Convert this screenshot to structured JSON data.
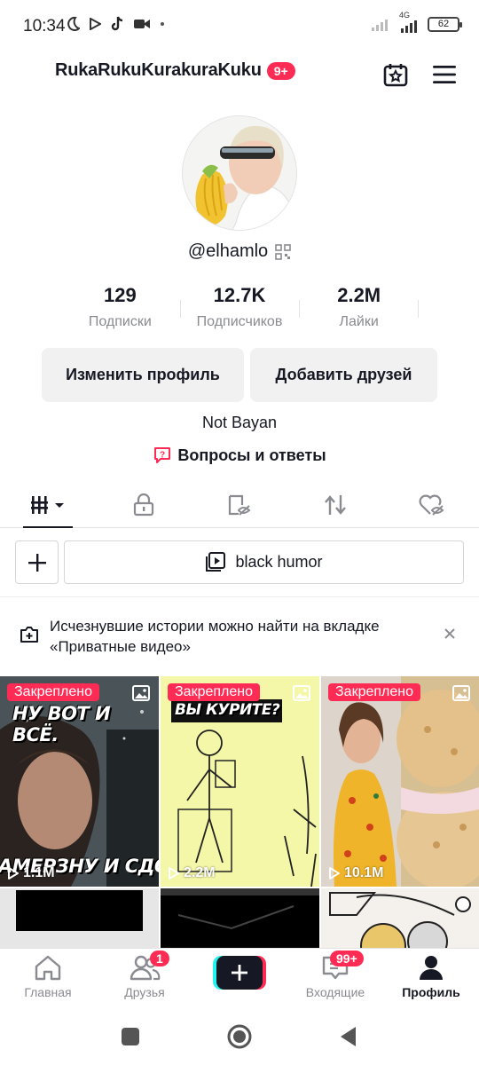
{
  "status_bar": {
    "time": "10:34",
    "network": "4G",
    "battery": "62"
  },
  "header": {
    "username": "RukaRukuKurakuraKuku",
    "notif_badge": "9+"
  },
  "profile": {
    "handle": "@elhamlo",
    "stats": [
      {
        "value": "129",
        "label": "Подписки"
      },
      {
        "value": "12.7K",
        "label": "Подписчиков"
      },
      {
        "value": "2.2M",
        "label": "Лайки"
      }
    ],
    "edit_button": "Изменить профиль",
    "add_friends_button": "Добавить друзей",
    "bio": "Not Bayan",
    "qa_link": "Вопросы и ответы"
  },
  "tabs": [
    {
      "icon": "grid-icon",
      "active": true
    },
    {
      "icon": "lock-icon",
      "active": false
    },
    {
      "icon": "eye-off-icon",
      "active": false
    },
    {
      "icon": "repost-icon",
      "active": false
    },
    {
      "icon": "heart-off-icon",
      "active": false
    }
  ],
  "playlist": {
    "add_label": "+",
    "name": "black humor"
  },
  "notice": {
    "text": "Исчезнувшие истории можно найти на вкладке «Приватные видео»"
  },
  "videos": [
    {
      "pinned": "Закреплено",
      "caption_top": "НУ ВОТ И ВСЁ.",
      "caption_bottom": "АМЕРЗНУ И СДОХ",
      "views": "1.1M"
    },
    {
      "pinned": "Закреплено",
      "caption_top": "ВЫ КУРИТЕ?",
      "views": "2.2M"
    },
    {
      "pinned": "Закреплено",
      "views": "10.1M"
    }
  ],
  "bottom_nav": [
    {
      "label": "Главная"
    },
    {
      "label": "Друзья",
      "badge": "1"
    },
    {
      "label": "+"
    },
    {
      "label": "Входящие",
      "badge": "99+"
    },
    {
      "label": "Профиль",
      "active": true
    }
  ],
  "colors": {
    "accent": "#fe2c55",
    "text": "#161823",
    "muted": "#8a8b91",
    "button_bg": "#f1f1f2"
  }
}
